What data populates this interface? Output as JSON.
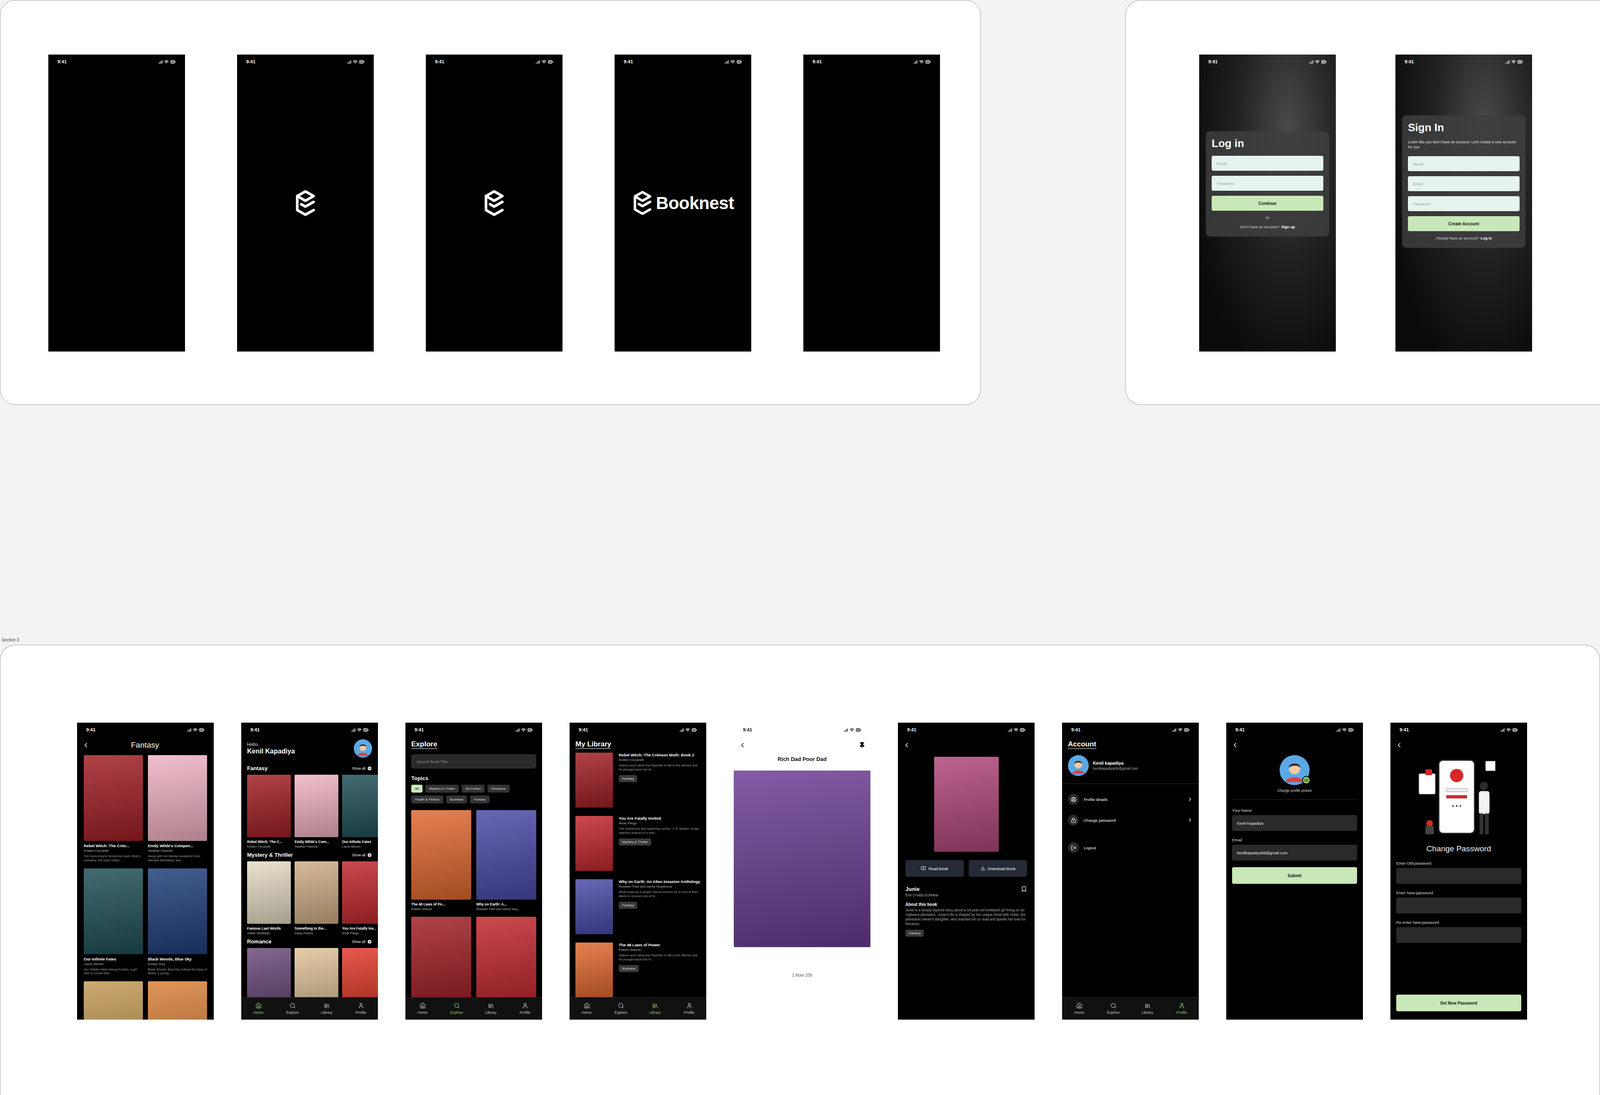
{
  "canvas": {
    "section_label": "Section 3"
  },
  "splash_screens": [
    {
      "time": "9:41",
      "kind": "blank"
    },
    {
      "time": "9:41",
      "kind": "mark"
    },
    {
      "time": "9:41",
      "kind": "mark"
    },
    {
      "time": "9:41",
      "kind": "wordmark",
      "wordmark": "Booknest"
    },
    {
      "time": "9:41",
      "kind": "blank"
    }
  ],
  "login": {
    "time": "9:41",
    "title": "Log in",
    "fields": [
      {
        "placeholder": "Email"
      },
      {
        "placeholder": "Password"
      }
    ],
    "button": "Continue",
    "divider": "Or",
    "footer": "Don't have an account?",
    "link": "Sign up"
  },
  "signup": {
    "time": "9:41",
    "title": "Sign In",
    "subtitle": "Looks like you don't have an account. Let's create a new account for you.",
    "fields": [
      {
        "placeholder": "Name"
      },
      {
        "placeholder": "Email"
      },
      {
        "placeholder": "Password"
      }
    ],
    "button": "Create Account",
    "footer": "Already have an account?",
    "link": "Log in"
  },
  "fantasy": {
    "time": "9:41",
    "title": "Fantasy",
    "books": [
      {
        "kind": "card",
        "title": "Rebel Witch: The Crim...",
        "author": "Kristen Ciccarelli",
        "blurb": "The more they're forced into each other's company, the more Gideo...",
        "color": "#a01f25"
      },
      {
        "kind": "card",
        "title": "Emily Wilde's Compen...",
        "author": "Heather Fawcett",
        "blurb": "Along with her familiar academic rival, Wendell Bambleby, and...",
        "color": "#f0b3c2"
      },
      {
        "kind": "card",
        "title": "Our Infinite Fates",
        "author": "Laura Steven",
        "blurb": "Our Infinite Fates follows Evelyn, a girl who is cursed with...",
        "color": "#1f4f57"
      },
      {
        "kind": "card",
        "title": "Black Woods, Blue Sky",
        "author": "Eowyn Ivey",
        "blurb": "Black Woods, Blue Sky follows the story of Birdie, a young...",
        "color": "#1f3f7a"
      },
      {
        "kind": "cover",
        "color": "#c49a55"
      },
      {
        "kind": "cover",
        "color": "#d9823a"
      }
    ]
  },
  "home": {
    "time": "9:41",
    "greeting": "Hello,",
    "name": "Kenil Kapadiya",
    "shelves": [
      {
        "title": "Fantasy",
        "action": "Show all",
        "books": [
          {
            "kind": "card",
            "title": "Rebel Witch: The C...",
            "author": "Kristen Ciccarelli",
            "color": "#a01f25"
          },
          {
            "kind": "card",
            "title": "Emily Wilde's Com...",
            "author": "Heather Fawcett",
            "color": "#f0b3c2"
          },
          {
            "kind": "card",
            "title": "Our Infinite Fates",
            "author": "Laura Steven",
            "color": "#1f4f57"
          }
        ]
      },
      {
        "title": "Mystery & Thriller",
        "action": "Show all",
        "books": [
          {
            "kind": "card",
            "title": "Famous Last Words",
            "author": "Gillian McAllister",
            "color": "#e6dcc4"
          },
          {
            "kind": "card",
            "title": "Something in the...",
            "author": "Daisy Pearce",
            "color": "#cfae86"
          },
          {
            "kind": "card",
            "title": "You Are Fatally Inv...",
            "author": "Ande Pliego",
            "color": "#c0272d"
          }
        ]
      },
      {
        "title": "Romance",
        "action": "Show all",
        "books": [
          {
            "kind": "cover",
            "color": "#6b4a7a"
          },
          {
            "kind": "cover",
            "color": "#e2c49a"
          },
          {
            "kind": "cover",
            "color": "#e23a2a"
          }
        ]
      }
    ],
    "nav": [
      {
        "label": "Home",
        "selected": true
      },
      {
        "label": "Explore",
        "selected": false
      },
      {
        "label": "Library",
        "selected": false
      },
      {
        "label": "Profile",
        "selected": false
      }
    ]
  },
  "explore": {
    "time": "9:41",
    "title": "Explore",
    "search_placeholder": "Search Book Title",
    "topics_label": "Topics",
    "topics": [
      {
        "label": "All",
        "selected": true
      },
      {
        "label": "Mystery & Thriller",
        "selected": false
      },
      {
        "label": "Sci-Fiction",
        "selected": false
      },
      {
        "label": "Romance",
        "selected": false
      },
      {
        "label": "Health & Fitness",
        "selected": false
      },
      {
        "label": "Business",
        "selected": false
      },
      {
        "label": "Fantasy",
        "selected": false
      }
    ],
    "books": [
      {
        "kind": "card",
        "title": "The 48 Laws of Po...",
        "author": "Robert Greene",
        "color": "#e0692f"
      },
      {
        "kind": "card",
        "title": "Why on Earth: A...",
        "author": "Roselee Thiel and Varna Stoy...",
        "color": "#4a4aa8"
      },
      {
        "kind": "cover",
        "color": "#a01f25"
      },
      {
        "kind": "cover",
        "color": "#c0272d"
      }
    ],
    "nav": [
      {
        "label": "Home",
        "selected": false
      },
      {
        "label": "Explore",
        "selected": true
      },
      {
        "label": "Library",
        "selected": false
      },
      {
        "label": "Profile",
        "selected": false
      }
    ]
  },
  "library": {
    "time": "9:41",
    "title": "My Library",
    "items": [
      {
        "title": "Rebel Witch: The Crimson Moth: Book 2",
        "author": "Kristen Ciccarelli",
        "blurb": "Gideon won't allow the Republic to fall to the witches and he plunged back into th...",
        "tag": "Fantasy",
        "color": "#a01f25"
      },
      {
        "title": "You Are Fatally Invited",
        "author": "Ande Pliego",
        "blurb": "The mysterious and legendary author, J. R. Alastor, invites selected authors to a writi...",
        "tag": "Mystery & Thriller",
        "color": "#c0272d"
      },
      {
        "title": "Why on Earth: An Alien Invasion Anthology",
        "author": "Roselee Thiel and Varna Stoyanova",
        "blurb": "What starts as a simple rescue mission for a crew of teen aliens to recover one of th...",
        "tag": "Fantasy",
        "color": "#4a4aa8"
      },
      {
        "title": "The 48 Laws of Power",
        "author": "Robert Greene",
        "blurb": "Gideon won't allow the Republic to fall to the witches and he plunged back into th...",
        "tag": "Business",
        "color": "#e0692f"
      }
    ],
    "nav": [
      {
        "label": "Home",
        "selected": false
      },
      {
        "label": "Explore",
        "selected": false
      },
      {
        "label": "Library",
        "selected": true
      },
      {
        "label": "Profile",
        "selected": false
      }
    ]
  },
  "reader": {
    "time": "9:41",
    "title": "Rich Dad Poor Dad",
    "page": "1 from 109",
    "color": "#6a3d94"
  },
  "detail": {
    "time": "9:41",
    "color": "#b0467a",
    "buttons": [
      "Read Book",
      "Download Book"
    ],
    "title": "Junie",
    "author": "Erin Crosby Eckstine",
    "about": "About this book",
    "description": "Junie is a deeply layered story about a 16-year-old enslaved girl living on an Alabama plantation. Junie's life is shaped by her unique bond with Violet, the plantation owner's daughter, who teaches her to read and sparks her love for literature.",
    "tag": "Fantasy"
  },
  "account": {
    "time": "9:41",
    "title": "Account",
    "name": "Kenil kapadiya",
    "email": "kenilkapadiya09@gmail.com",
    "menu": [
      {
        "label": "Profile details",
        "kind": "link"
      },
      {
        "label": "Change password",
        "kind": "link"
      },
      {
        "label": "Logout",
        "kind": "action"
      }
    ],
    "nav": [
      {
        "label": "Home",
        "selected": false
      },
      {
        "label": "Explore",
        "selected": false
      },
      {
        "label": "Library",
        "selected": false
      },
      {
        "label": "Profile",
        "selected": true
      }
    ]
  },
  "edit_profile": {
    "time": "9:41",
    "caption": "Change profile picture",
    "fields": [
      {
        "label": "Your Name",
        "value": "Kenil Kapadiya"
      },
      {
        "label": "Email",
        "value": "kenilkapadiya09@gmail.com"
      }
    ],
    "button": "Submit"
  },
  "change_password": {
    "time": "9:41",
    "title": "Change Password",
    "fields": [
      {
        "label": "Enter Old-password"
      },
      {
        "label": "Enter New-password"
      },
      {
        "label": "Re-enter New-password"
      }
    ],
    "button": "Set New Password"
  }
}
